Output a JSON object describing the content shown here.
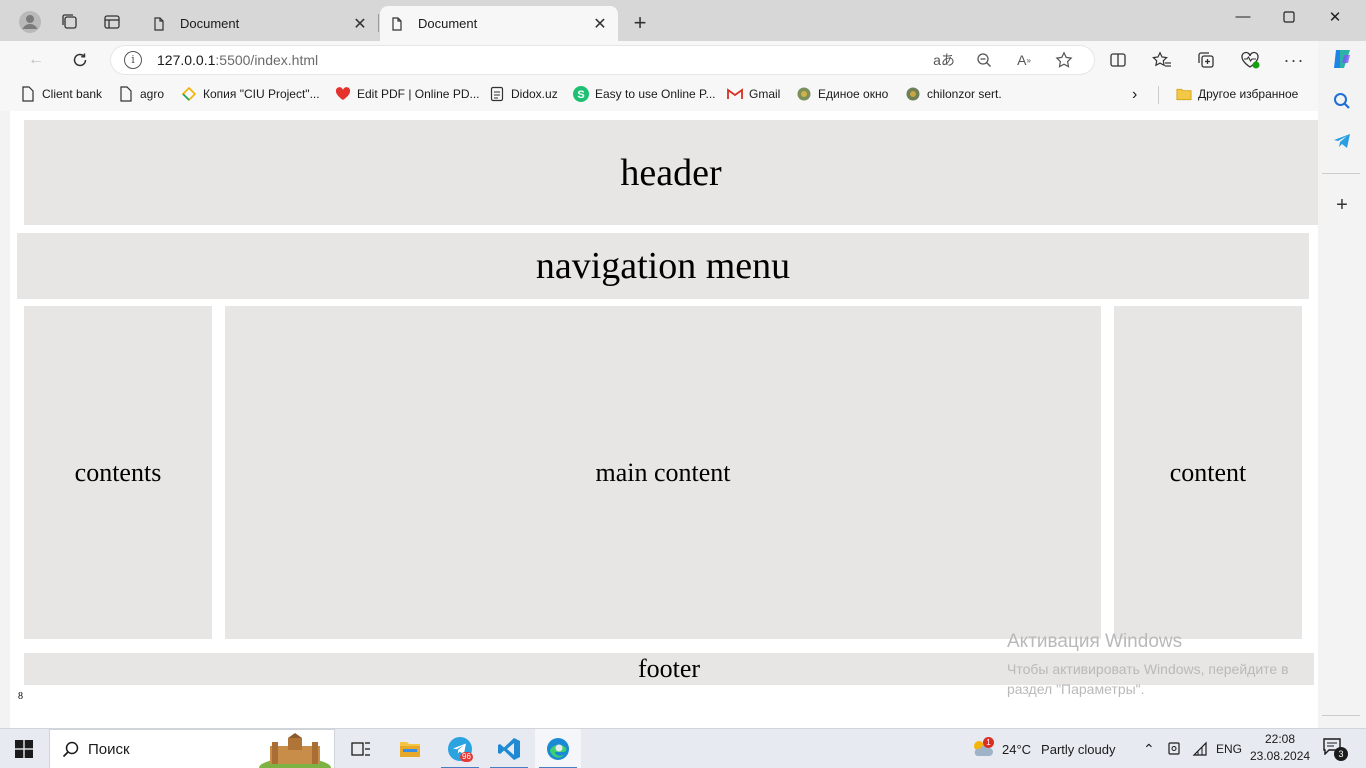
{
  "tabs": [
    {
      "title": "Document",
      "active": false
    },
    {
      "title": "Document",
      "active": true
    }
  ],
  "address_bar": {
    "url_host": "127.0.0.1",
    "url_rest": ":5500/index.html"
  },
  "favorites": [
    {
      "label": "Client bank",
      "icon": "document-icon"
    },
    {
      "label": "agro",
      "icon": "document-icon"
    },
    {
      "label": "Копия \"CIU Project\"...",
      "icon": "drive-icon"
    },
    {
      "label": "Edit PDF | Online PD...",
      "icon": "heart-icon"
    },
    {
      "label": "Didox.uz",
      "icon": "doc-icon"
    },
    {
      "label": "Easy to use Online P...",
      "icon": "s-icon"
    },
    {
      "label": "Gmail",
      "icon": "gmail-icon"
    },
    {
      "label": "Единое окно",
      "icon": "emblem-icon"
    },
    {
      "label": "chilonzor sert.",
      "icon": "emblem-icon"
    }
  ],
  "other_favorites": "Другое избранное",
  "page": {
    "header": "header",
    "nav": "navigation menu",
    "left": "contents",
    "main": "main content",
    "right": "content",
    "footer": "footer",
    "page_number": "8"
  },
  "activation": {
    "title": "Активация Windows",
    "text": "Чтобы активировать Windows, перейдите в раздел \"Параметры\"."
  },
  "taskbar": {
    "search_label": "Поиск",
    "telegram_badge": "96",
    "weather_badge": "1",
    "temperature": "24°C",
    "weather": "Partly cloudy",
    "language": "ENG",
    "time": "22:08",
    "date": "23.08.2024",
    "notifications": "3"
  },
  "colors": {
    "box_fill": "#e8e5e5",
    "tabstrip": "#d7d7d7",
    "accent_blue": "#0a5fd0"
  }
}
